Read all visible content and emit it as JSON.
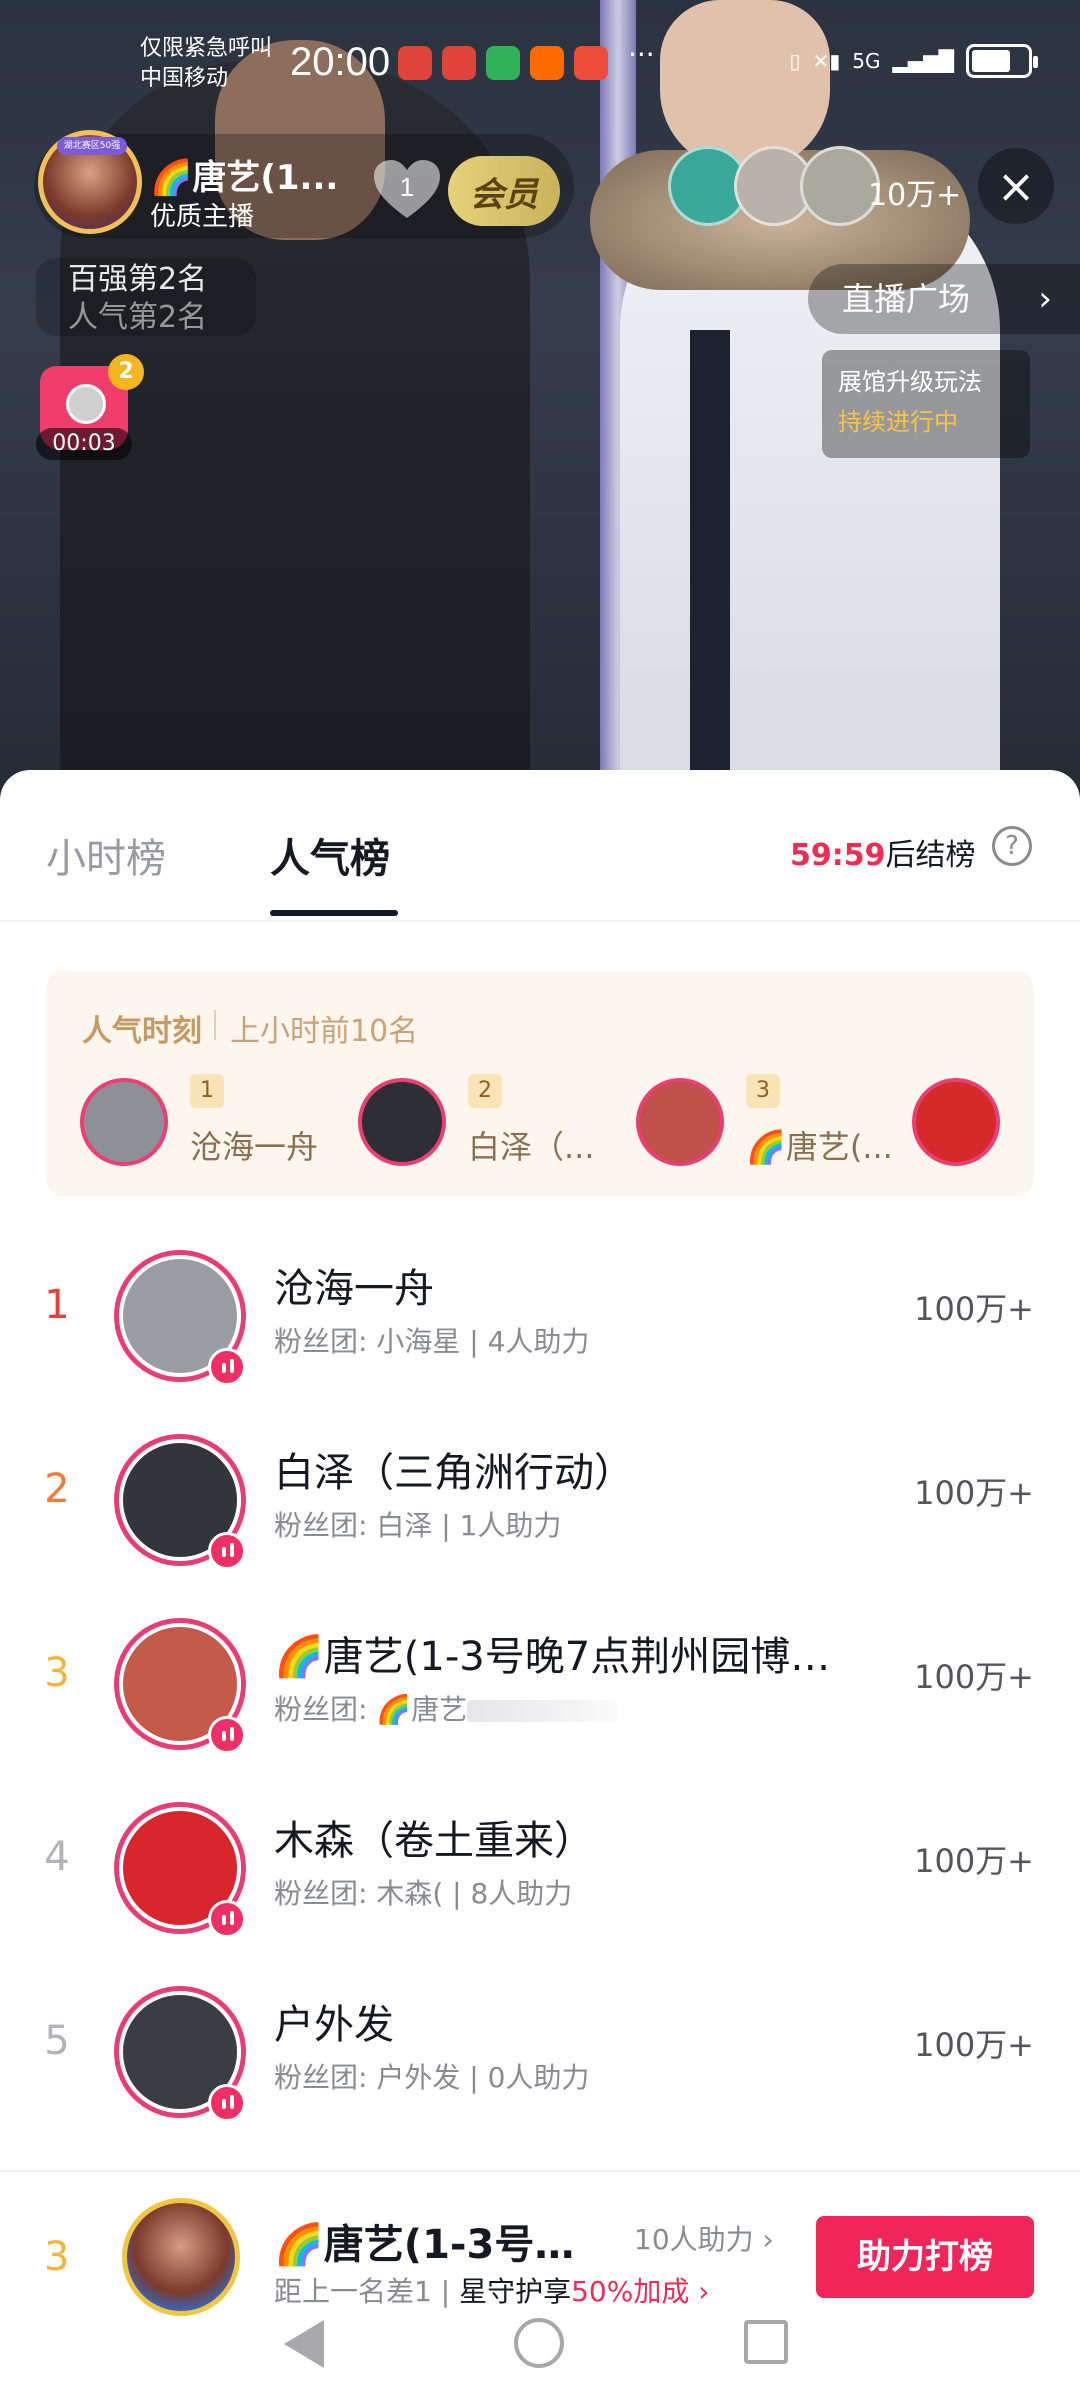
{
  "status_bar": {
    "emergency": "仅限紧急呼叫",
    "carrier": "中国移动",
    "time": "20:00",
    "more": "···",
    "signal": "5G",
    "apps": [
      {
        "icon": "huawei-store-icon",
        "color": "#e0453a"
      },
      {
        "icon": "huawei-app-icon",
        "color": "#e0453a"
      },
      {
        "icon": "green-app-icon",
        "color": "#2fb25a"
      },
      {
        "icon": "taobao-icon",
        "color": "#ff6a00"
      },
      {
        "icon": "red-app-icon",
        "color": "#ee4b3a"
      }
    ]
  },
  "live": {
    "host_name": "🌈唐艺(1...",
    "host_sub": "优质主播",
    "host_ribbon": "湖北赛区50强",
    "like_count": "1",
    "vip_label": "会员",
    "viewer_count": "10万+",
    "rank_lines": [
      "百强第2名",
      "人气第2名"
    ],
    "redpack_count": "2",
    "redpack_timer": "00:03",
    "plaza_label": "直播广场",
    "expo_title": "展馆升级玩法",
    "expo_status": "持续进行中"
  },
  "tabs": {
    "hour": "小时榜",
    "popularity": "人气榜",
    "countdown_time": "59:59",
    "countdown_suffix": "后结榜",
    "help": "?"
  },
  "moment": {
    "title": "人气时刻",
    "subtitle": "上小时前10名",
    "items": [
      {
        "rank": "1",
        "name": "沧海一舟",
        "avatar_color": "#8d9197"
      },
      {
        "rank": "2",
        "name": "白泽（...",
        "avatar_color": "#2d2f36"
      },
      {
        "rank": "3",
        "name": "🌈唐艺(...",
        "avatar_color": "#c0504a"
      },
      {
        "rank": "",
        "name": "",
        "avatar_color": "#d42a2a"
      }
    ]
  },
  "ranking": [
    {
      "rank": "1",
      "name": "沧海一舟",
      "fans": "粉丝团:  小海星 | 4人助力",
      "score": "100万+",
      "rank_color": "#e0423f",
      "avatar_color": "#9a9ea4"
    },
    {
      "rank": "2",
      "name": "白泽（三角洲行动）",
      "fans": "粉丝团:  白泽 | 1人助力",
      "score": "100万+",
      "rank_color": "#f07a3a",
      "avatar_color": "#33353d"
    },
    {
      "rank": "3",
      "name": "🌈唐艺(1-3号晚7点荆州园博…",
      "fans": "粉丝团:  🌈唐艺",
      "score": "100万+",
      "rank_color": "#f2b43b",
      "avatar_color": "#c35a4a"
    },
    {
      "rank": "4",
      "name": "木森（卷土重来）",
      "fans": "粉丝团:  木森( | 8人助力",
      "score": "100万+",
      "rank_color": "#b3b3b8",
      "avatar_color": "#d8262c"
    },
    {
      "rank": "5",
      "name": "户外发",
      "fans": "粉丝团:  户外发 | 0人助力",
      "score": "100万+",
      "rank_color": "#b3b3b8",
      "avatar_color": "#3b3d44"
    }
  ],
  "my_rank": {
    "rank": "3",
    "name": "🌈唐艺(1-3号…",
    "helpers": "10人助力 ›",
    "gap": "距上一名差1 | ",
    "guard": "星守护享",
    "bonus": "50%加成 ›",
    "button": "助力打榜"
  }
}
